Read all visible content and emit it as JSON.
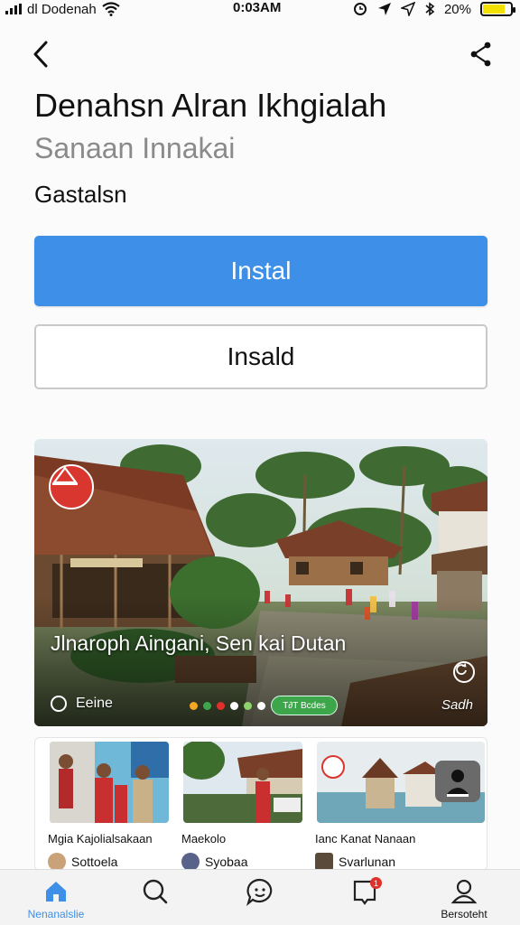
{
  "status_bar": {
    "carrier": "dl Dodenah",
    "time": "0:03AM",
    "battery_text": "20%",
    "battery_level": 0.8,
    "battery_color": "#f2e000"
  },
  "nav": {
    "back_icon": "chevron-left-icon",
    "share_icon": "share-icon"
  },
  "app": {
    "title": "Denahsn Alran Ikhgialah",
    "subtitle": "Sanaan Innakai",
    "category": "Gastalsn"
  },
  "buttons": {
    "primary_label": "Instal",
    "secondary_label": "Insald",
    "primary_color": "#3d8fe8"
  },
  "hero": {
    "caption": "Jlnaroph Aingani, Sen kai Dutan",
    "play_label": "Eeine",
    "pill_label": "T∂T Bcdes",
    "more_label": "Sadh",
    "dot_colors": [
      "#f5a623",
      "#3ea64a",
      "#e0302a",
      "#ffffff",
      "#8fd46a",
      "#ffffff"
    ]
  },
  "cards": [
    {
      "title": "Mgia Kajolialsakaan",
      "author": "Sottoela"
    },
    {
      "title": "Maekolo",
      "author": "Syobaa"
    },
    {
      "title": "Ianc Kanat Nanaan",
      "author": "Svarlunan"
    }
  ],
  "tabs": [
    {
      "label": "Nenanalslie",
      "icon": "home-icon",
      "active": true
    },
    {
      "label": "",
      "icon": "search-icon",
      "active": false
    },
    {
      "label": "",
      "icon": "chat-icon",
      "active": false
    },
    {
      "label": "",
      "icon": "bookmark-icon",
      "active": false,
      "badge": "1"
    },
    {
      "label": "Bersoteht",
      "icon": "profile-icon",
      "active": false
    }
  ]
}
